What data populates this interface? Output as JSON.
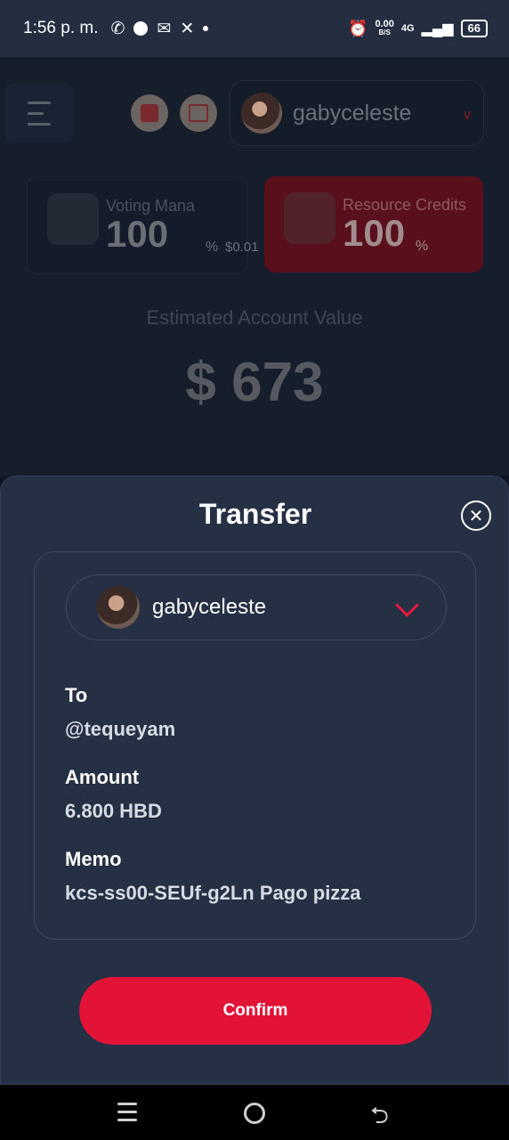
{
  "status_bar": {
    "time": "1:56 p. m.",
    "net_speed": "0.00",
    "net_unit": "B/S",
    "network": "4G",
    "battery": "66"
  },
  "app": {
    "account": "gabyceleste",
    "voting_mana": {
      "label": "Voting Mana",
      "value": "100",
      "unit": "%",
      "extra": "$0.01"
    },
    "resource_credits": {
      "label": "Resource Credits",
      "value": "100",
      "unit": "%"
    },
    "estimated_label": "Estimated Account Value",
    "estimated_value": "$ 673"
  },
  "modal": {
    "title": "Transfer",
    "from_account": "gabyceleste",
    "to_label": "To",
    "to_value": "@tequeyam",
    "amount_label": "Amount",
    "amount_value": "6.800 HBD",
    "memo_label": "Memo",
    "memo_value": "kcs-ss00-SEUf-g2Ln Pago pizza",
    "confirm_label": "Confirm"
  },
  "colors": {
    "accent": "#e31337",
    "modal_bg": "#253045",
    "status_bg": "#242e40"
  }
}
